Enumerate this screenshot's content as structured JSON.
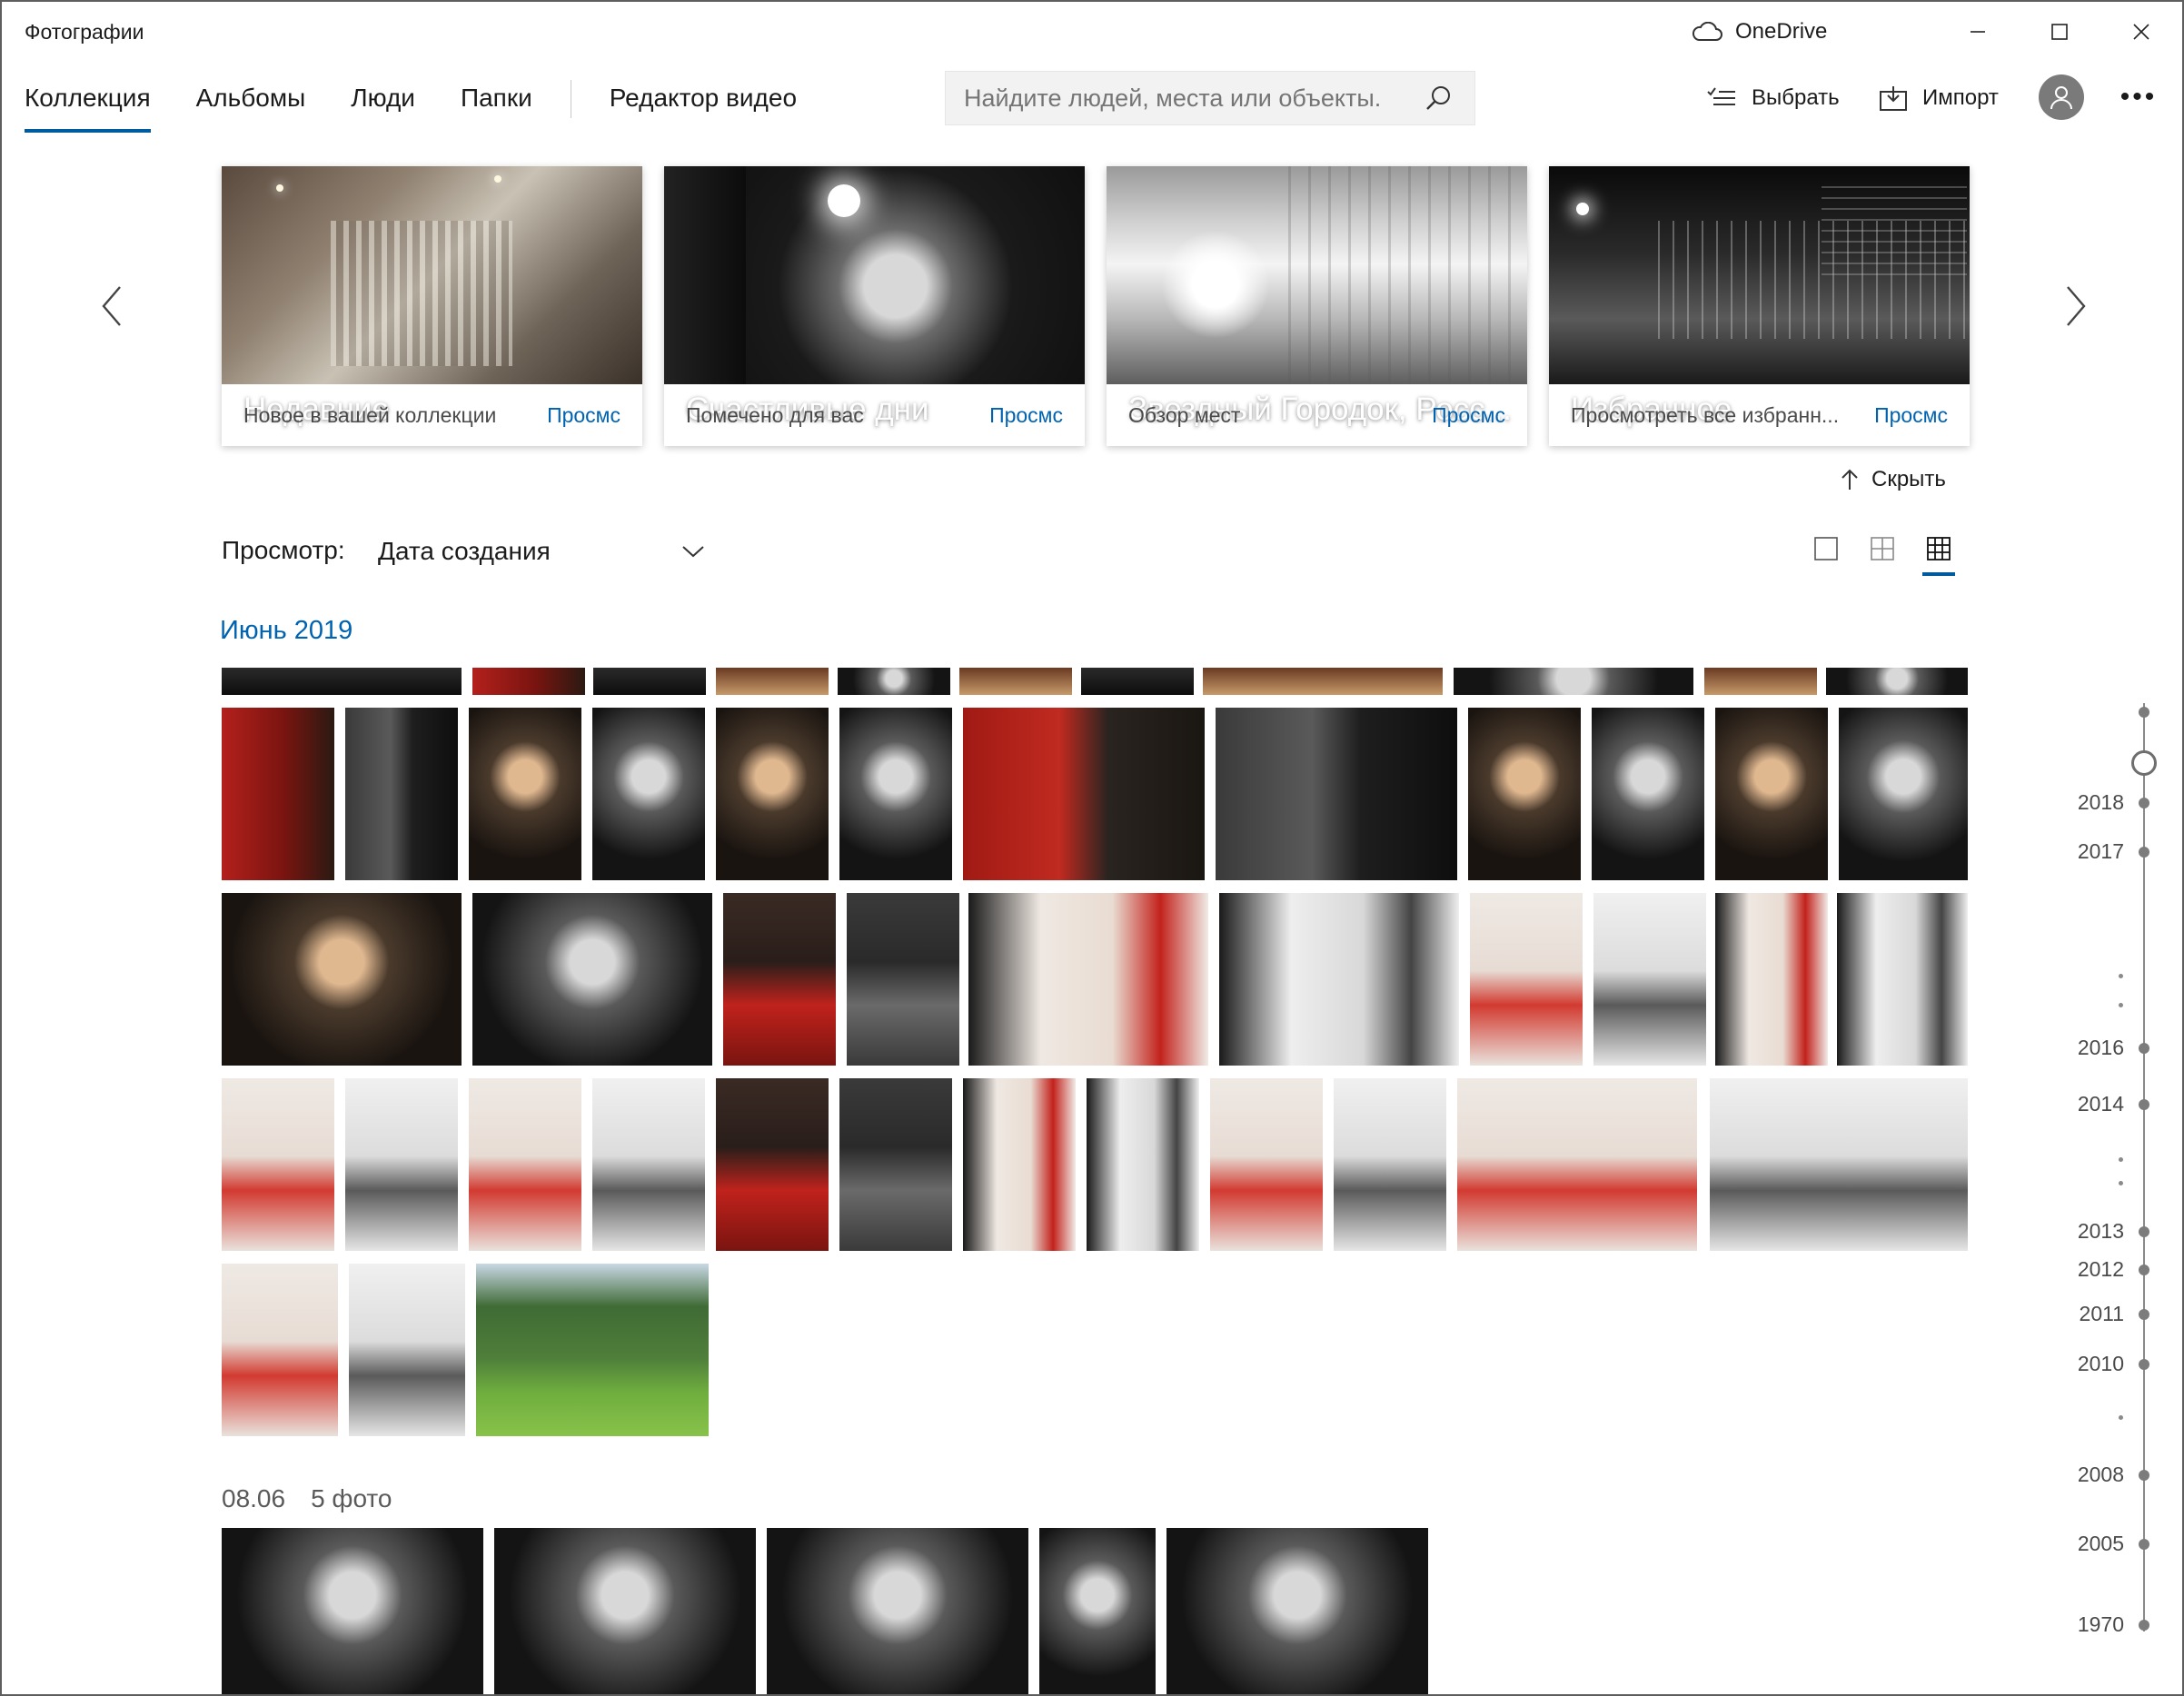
{
  "app": {
    "title": "Фотографии",
    "onedrive_label": "OneDrive"
  },
  "nav": {
    "tabs": [
      "Коллекция",
      "Альбомы",
      "Люди",
      "Папки"
    ],
    "video_editor": "Редактор видео"
  },
  "search": {
    "placeholder": "Найдите людей, места или объекты."
  },
  "commands": {
    "select": "Выбрать",
    "import": "Импорт"
  },
  "cards": [
    {
      "title": "Недавние",
      "subtitle": "Новое в вашей коллекции",
      "link": "Просмс"
    },
    {
      "title": "Счастливые дни",
      "subtitle": "Помечено для вас",
      "link": "Просмс"
    },
    {
      "title": "Звездный Городок, Росс...",
      "subtitle": "Обзор мест",
      "link": "Просмс"
    },
    {
      "title": "Избранное",
      "subtitle": "Просмотреть все избранн...",
      "link": "Просмс"
    }
  ],
  "hide_label": "Скрыть",
  "view": {
    "label": "Просмотр:",
    "selected": "Дата создания"
  },
  "section": {
    "month": "Июнь 2019",
    "group_date": "08.06",
    "group_count": "5 фото"
  },
  "timeline": {
    "years": [
      "2018",
      "2017",
      "2016",
      "2014",
      "2013",
      "2012",
      "2011",
      "2010",
      "2008",
      "2005",
      "1970"
    ]
  },
  "colors": {
    "accent": "#0063b1",
    "underline": "#005a9e"
  },
  "icons": {
    "cloud": "onedrive-cloud-icon",
    "search": "magnifier-icon",
    "select": "checklist-icon",
    "import": "import-tray-icon",
    "avatar": "person-icon",
    "more": "ellipsis-icon"
  }
}
